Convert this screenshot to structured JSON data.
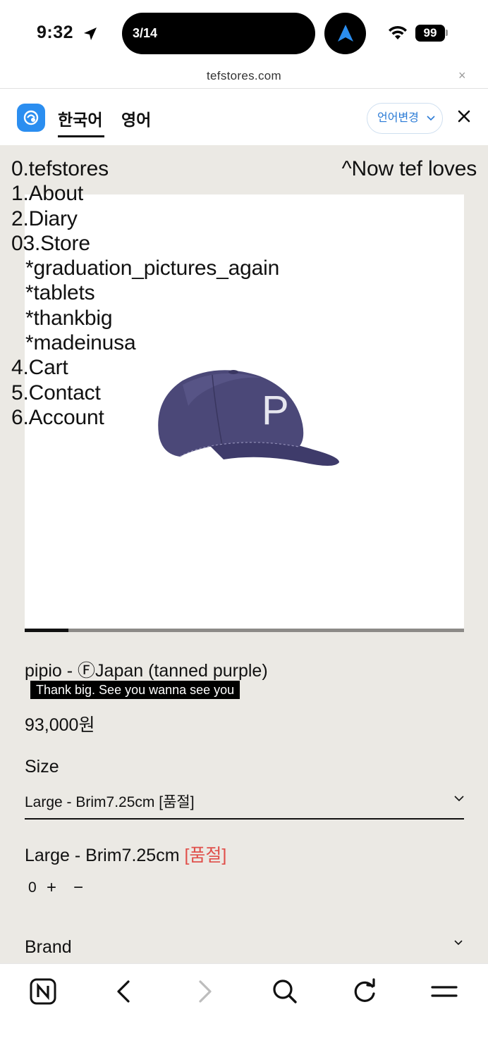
{
  "status_bar": {
    "time": "9:32",
    "tab_counter": "3/14",
    "battery": "99"
  },
  "url_bar": {
    "domain": "tefstores.com",
    "close_glyph": "×"
  },
  "translate_bar": {
    "tab_korean": "한국어",
    "tab_english": "영어",
    "change_language_button": "언어변경"
  },
  "site_menu": {
    "items": [
      {
        "label": "0.tefstores",
        "sub": false
      },
      {
        "label": "1.About",
        "sub": false
      },
      {
        "label": "2.Diary",
        "sub": false
      },
      {
        "label": "03.Store",
        "sub": false
      },
      {
        "label": "*graduation_pictures_again",
        "sub": true
      },
      {
        "label": "*tablets",
        "sub": true
      },
      {
        "label": "*thankbig",
        "sub": true
      },
      {
        "label": "*madeinusa",
        "sub": true
      },
      {
        "label": "4.Cart",
        "sub": false
      },
      {
        "label": "5.Contact",
        "sub": false
      },
      {
        "label": "6.Account",
        "sub": false
      }
    ],
    "now_loves": "^Now tef loves"
  },
  "product": {
    "image_icon": "purple-cap-image",
    "cap_letter": "P",
    "title": "pipio - ⒻJapan (tanned purple)",
    "tag": "Thank big. See you wanna see you",
    "price": "93,000원",
    "size_label": "Size",
    "size_selected": "Large - Brim7.25cm [품절]",
    "selected_option_name": "Large - Brim7.25cm",
    "selected_option_status": "[품절]",
    "quantity": "0",
    "plus": "+",
    "minus": "−",
    "brand_label": "Brand",
    "slider_progress": 0.1
  },
  "colors": {
    "page_bg": "#ebe9e4",
    "accent_blue": "#2b8ef0",
    "soldout_red": "#e0504b",
    "cap_navy": "#4b4878"
  },
  "toolbar": {
    "icons": [
      "naver-n-icon",
      "back-icon",
      "forward-icon",
      "search-icon",
      "reload-icon",
      "menu-icon"
    ]
  }
}
